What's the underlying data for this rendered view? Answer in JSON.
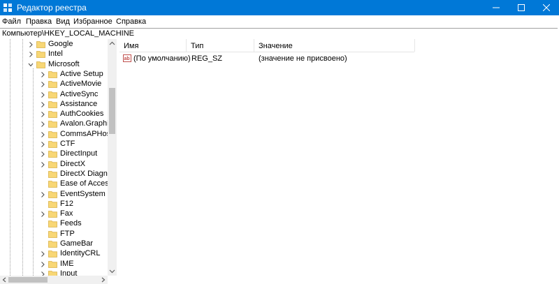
{
  "window": {
    "title": "Редактор реестра",
    "accent": "#0078d7",
    "icons": {
      "app": "registry-editor-icon",
      "minimize": "minimize-icon",
      "maximize": "maximize-icon",
      "close": "close-icon"
    }
  },
  "menu": [
    "Файл",
    "Правка",
    "Вид",
    "Избранное",
    "Справка"
  ],
  "address": "Компьютер\\HKEY_LOCAL_MACHINE",
  "tree": {
    "items": [
      {
        "label": "Google",
        "level": 1,
        "expanded": false
      },
      {
        "label": "Intel",
        "level": 1,
        "expanded": false
      },
      {
        "label": "Microsoft",
        "level": 1,
        "expanded": true
      },
      {
        "label": "Active Setup",
        "level": 2,
        "expanded": false
      },
      {
        "label": "ActiveMovie",
        "level": 2,
        "expanded": false
      },
      {
        "label": "ActiveSync",
        "level": 2,
        "expanded": false
      },
      {
        "label": "Assistance",
        "level": 2,
        "expanded": false
      },
      {
        "label": "AuthCookies",
        "level": 2,
        "expanded": false
      },
      {
        "label": "Avalon.Graphics",
        "level": 2,
        "expanded": false
      },
      {
        "label": "CommsAPHost",
        "level": 2,
        "expanded": false
      },
      {
        "label": "CTF",
        "level": 2,
        "expanded": false
      },
      {
        "label": "DirectInput",
        "level": 2,
        "expanded": false
      },
      {
        "label": "DirectX",
        "level": 2,
        "expanded": false
      },
      {
        "label": "DirectX Diagnosti",
        "level": 2,
        "expanded": null
      },
      {
        "label": "Ease of Access",
        "level": 2,
        "expanded": null
      },
      {
        "label": "EventSystem",
        "level": 2,
        "expanded": false
      },
      {
        "label": "F12",
        "level": 2,
        "expanded": null
      },
      {
        "label": "Fax",
        "level": 2,
        "expanded": false
      },
      {
        "label": "Feeds",
        "level": 2,
        "expanded": null
      },
      {
        "label": "FTP",
        "level": 2,
        "expanded": null
      },
      {
        "label": "GameBar",
        "level": 2,
        "expanded": null
      },
      {
        "label": "IdentityCRL",
        "level": 2,
        "expanded": false
      },
      {
        "label": "IME",
        "level": 2,
        "expanded": false
      },
      {
        "label": "Input",
        "level": 2,
        "expanded": false
      }
    ]
  },
  "values_pane": {
    "columns": [
      "Имя",
      "Тип",
      "Значение"
    ],
    "rows": [
      {
        "name": "(По умолчанию)",
        "type": "REG_SZ",
        "data": "(значение не присвоено)",
        "icon": "string-value-icon"
      }
    ]
  }
}
